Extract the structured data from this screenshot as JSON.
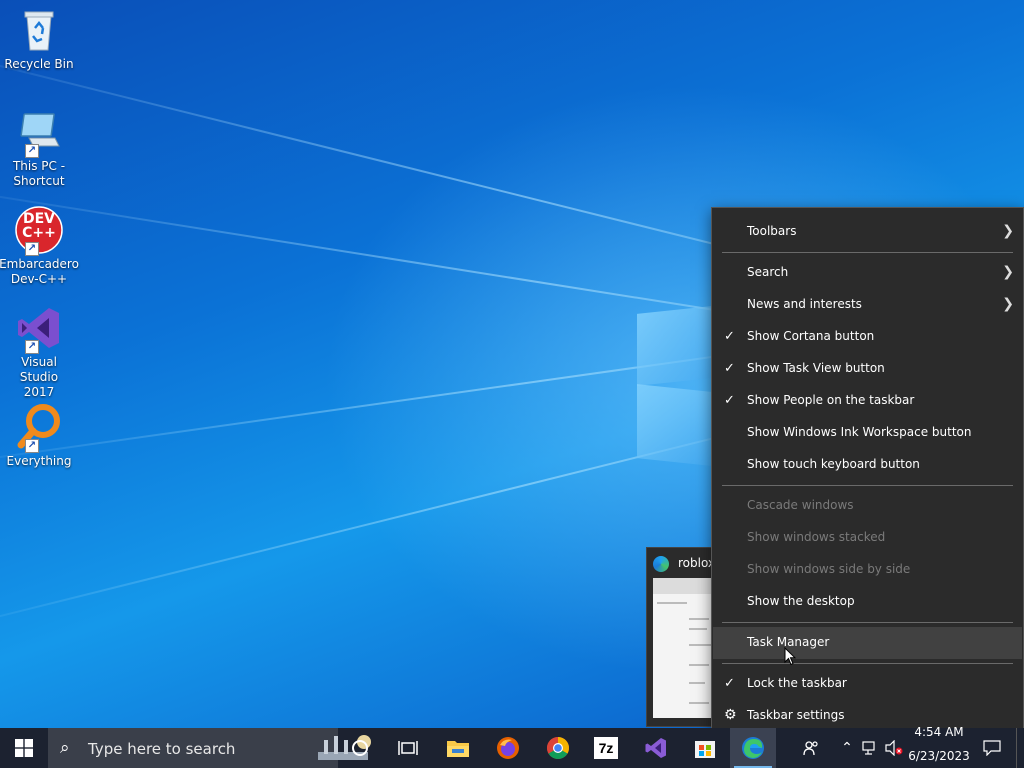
{
  "desktop": {
    "icons": [
      {
        "label": "Recycle Bin",
        "name": "recycle-bin-icon"
      },
      {
        "label": "This PC -\nShortcut",
        "name": "this-pc-icon"
      },
      {
        "label": "Embarcadero\nDev-C++",
        "name": "devcpp-icon"
      },
      {
        "label": "Visual Studio\n2017",
        "name": "visual-studio-icon"
      },
      {
        "label": "Everything",
        "name": "everything-icon"
      }
    ],
    "devcpp_logo_text": "DEV C++"
  },
  "thumbnail": {
    "title": "roblox"
  },
  "context_menu": {
    "toolbars": "Toolbars",
    "search": "Search",
    "news": "News and interests",
    "show_cortana": "Show Cortana button",
    "show_taskview": "Show Task View button",
    "show_people": "Show People on the taskbar",
    "show_ink": "Show Windows Ink Workspace button",
    "show_touch_keyboard": "Show touch keyboard button",
    "cascade": "Cascade windows",
    "stacked": "Show windows stacked",
    "side_by_side": "Show windows side by side",
    "show_desktop": "Show the desktop",
    "task_manager": "Task Manager",
    "lock_taskbar": "Lock the taskbar",
    "taskbar_settings": "Taskbar settings"
  },
  "taskbar": {
    "search_placeholder": "Type here to search",
    "clock_time": "4:54 AM",
    "clock_date": "6/23/2023",
    "seven_zip_label": "7z"
  },
  "colors": {
    "menu_bg": "#2b2b2b",
    "taskbar_bg": "#1c2230",
    "highlight": "#414141",
    "accent": "#76b9ed"
  }
}
